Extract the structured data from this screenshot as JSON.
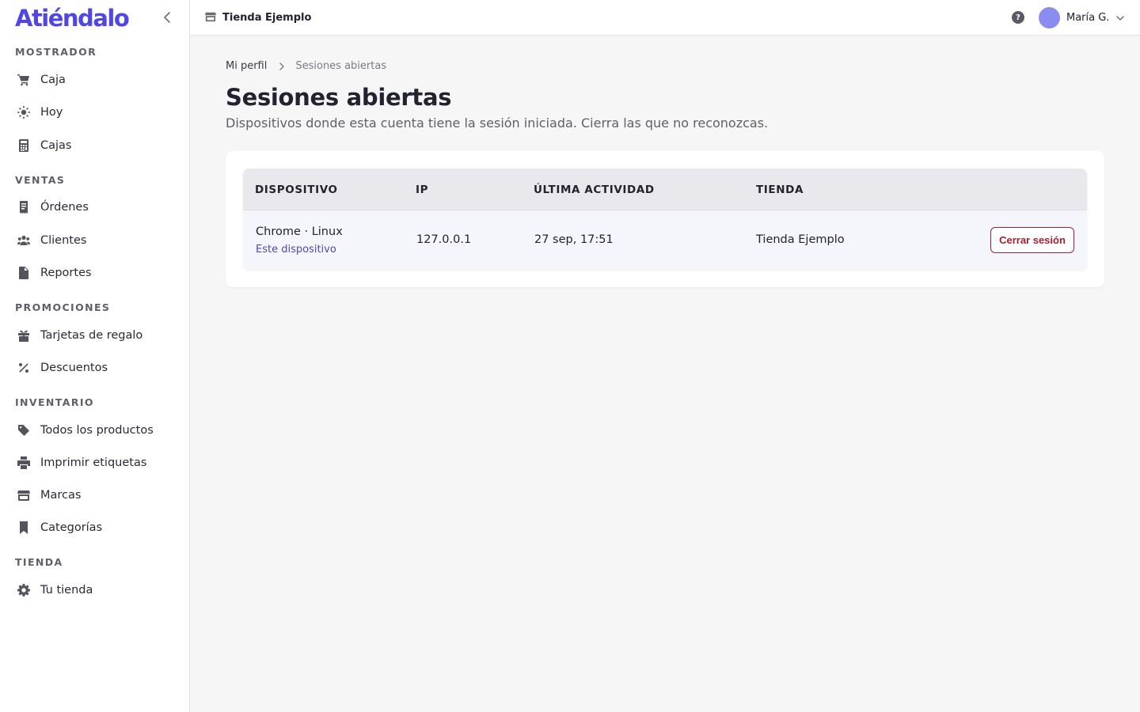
{
  "app": {
    "logo": "Atiéndalo"
  },
  "sidebar": {
    "sections": [
      {
        "title": "MOSTRADOR",
        "items": [
          {
            "label": "Caja",
            "icon": "cart-icon"
          },
          {
            "label": "Hoy",
            "icon": "sun-icon"
          },
          {
            "label": "Cajas",
            "icon": "calculator-icon"
          }
        ]
      },
      {
        "title": "VENTAS",
        "items": [
          {
            "label": "Órdenes",
            "icon": "receipt-icon"
          },
          {
            "label": "Clientes",
            "icon": "users-icon"
          },
          {
            "label": "Reportes",
            "icon": "document-icon"
          }
        ]
      },
      {
        "title": "PROMOCIONES",
        "items": [
          {
            "label": "Tarjetas de regalo",
            "icon": "gift-icon"
          },
          {
            "label": "Descuentos",
            "icon": "percent-icon"
          }
        ]
      },
      {
        "title": "INVENTARIO",
        "items": [
          {
            "label": "Todos los productos",
            "icon": "tag-icon"
          },
          {
            "label": "Imprimir etiquetas",
            "icon": "printer-icon"
          },
          {
            "label": "Marcas",
            "icon": "storefront-icon"
          },
          {
            "label": "Categorías",
            "icon": "bookmark-icon"
          }
        ]
      },
      {
        "title": "TIENDA",
        "items": [
          {
            "label": "Tu tienda",
            "icon": "gear-icon"
          }
        ]
      }
    ]
  },
  "topbar": {
    "store_name": "Tienda Ejemplo",
    "help_label": "?",
    "user_name": "María G."
  },
  "breadcrumb": {
    "parent": "Mi perfil",
    "current": "Sesiones abiertas"
  },
  "page": {
    "title": "Sesiones abiertas",
    "subtitle": "Dispositivos donde esta cuenta tiene la sesión iniciada. Cierra las que no reconozcas."
  },
  "sessions_table": {
    "columns": [
      "DISPOSITIVO",
      "IP",
      "ÚLTIMA ACTIVIDAD",
      "TIENDA"
    ],
    "rows": [
      {
        "device": "Chrome · Linux",
        "device_note": "Este dispositivo",
        "ip": "127.0.0.1",
        "last_activity": "27 sep, 17:51",
        "store": "Tienda Ejemplo",
        "action_label": "Cerrar sesión"
      }
    ]
  },
  "colors": {
    "brand": "#4f46e5",
    "danger": "#a81e2e",
    "row_highlight": "#f4f6fc",
    "avatar": "#8b8cf0"
  }
}
